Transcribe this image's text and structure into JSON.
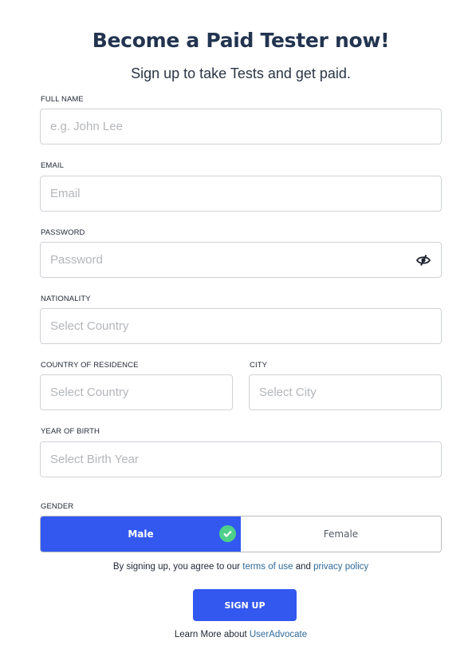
{
  "header": {
    "title": "Become a Paid Tester now!",
    "subtitle": "Sign up to take Tests and get paid."
  },
  "form": {
    "full_name": {
      "label": "FULL NAME",
      "placeholder": "e.g. John Lee",
      "value": ""
    },
    "email": {
      "label": "EMAIL",
      "placeholder": "Email",
      "value": ""
    },
    "password": {
      "label": "PASSWORD",
      "placeholder": "Password",
      "value": "",
      "toggle_icon": "eye-slash-icon"
    },
    "nationality": {
      "label": "NATIONALITY",
      "placeholder": "Select Country"
    },
    "country_of_residence": {
      "label": "COUNTRY OF RESIDENCE",
      "placeholder": "Select Country"
    },
    "city": {
      "label": "CITY",
      "placeholder": "Select City"
    },
    "year_of_birth": {
      "label": "YEAR OF BIRTH",
      "placeholder": "Select Birth Year"
    },
    "gender": {
      "label": "GENDER",
      "options": [
        "Male",
        "Female"
      ],
      "selected": "Male"
    }
  },
  "terms": {
    "prefix": "By signing up, you agree to our ",
    "terms_link": "terms of use",
    "middle": " and ",
    "privacy_link": "privacy policy"
  },
  "signup_button": "SIGN UP",
  "learn_more": {
    "prefix": "Learn More about ",
    "link": "UserAdvocate"
  },
  "colors": {
    "primary": "#3358f0",
    "check": "#4fd08a",
    "heading": "#22344f",
    "link": "#2e6a9a"
  }
}
